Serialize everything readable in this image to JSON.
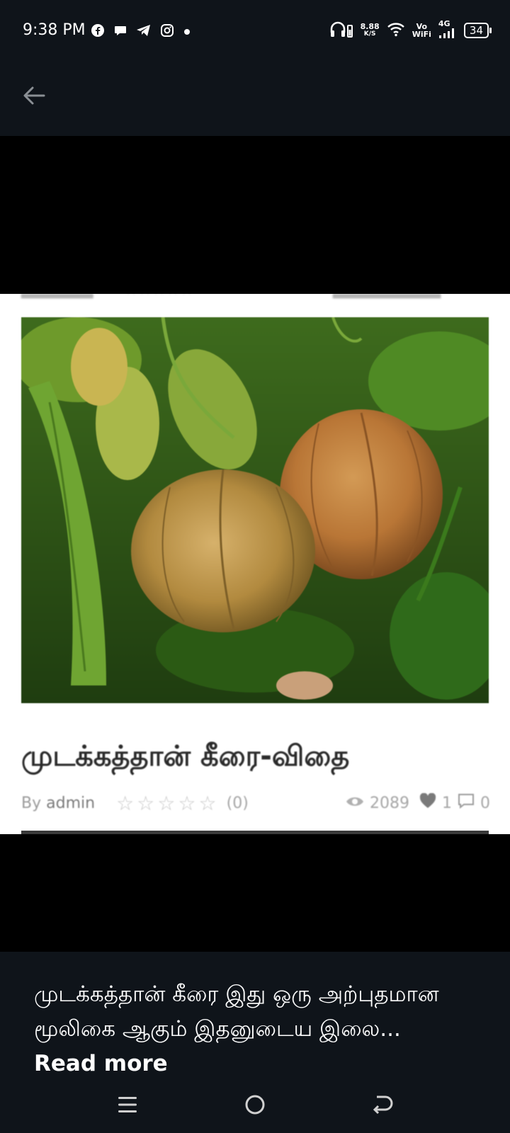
{
  "status_bar": {
    "time": "9:38 PM",
    "net_speed_value": "8.88",
    "net_speed_unit": "K/S",
    "volte_top": "Vo",
    "volte_bottom": "WiFi",
    "network_type": "4G",
    "battery_level": "34",
    "app_icons": [
      "facebook-icon",
      "chat-icon",
      "telegram-icon",
      "instagram-icon",
      "dot-icon"
    ]
  },
  "post": {
    "title": "முடக்கத்தான் கீரை-விதை",
    "by_label": "By",
    "author": "admin",
    "rating_count": "(0)",
    "views": "2089",
    "likes": "1",
    "comments": "0"
  },
  "caption": {
    "text": "முடக்கத்தான் கீரை இது ஒரு அற்புதமான மூலிகை ஆகும் இதனுடைய இலை...",
    "read_more": "Read more"
  },
  "colors": {
    "bar_background": "#0f141a",
    "media_background": "#000000",
    "card_background": "#ffffff"
  }
}
